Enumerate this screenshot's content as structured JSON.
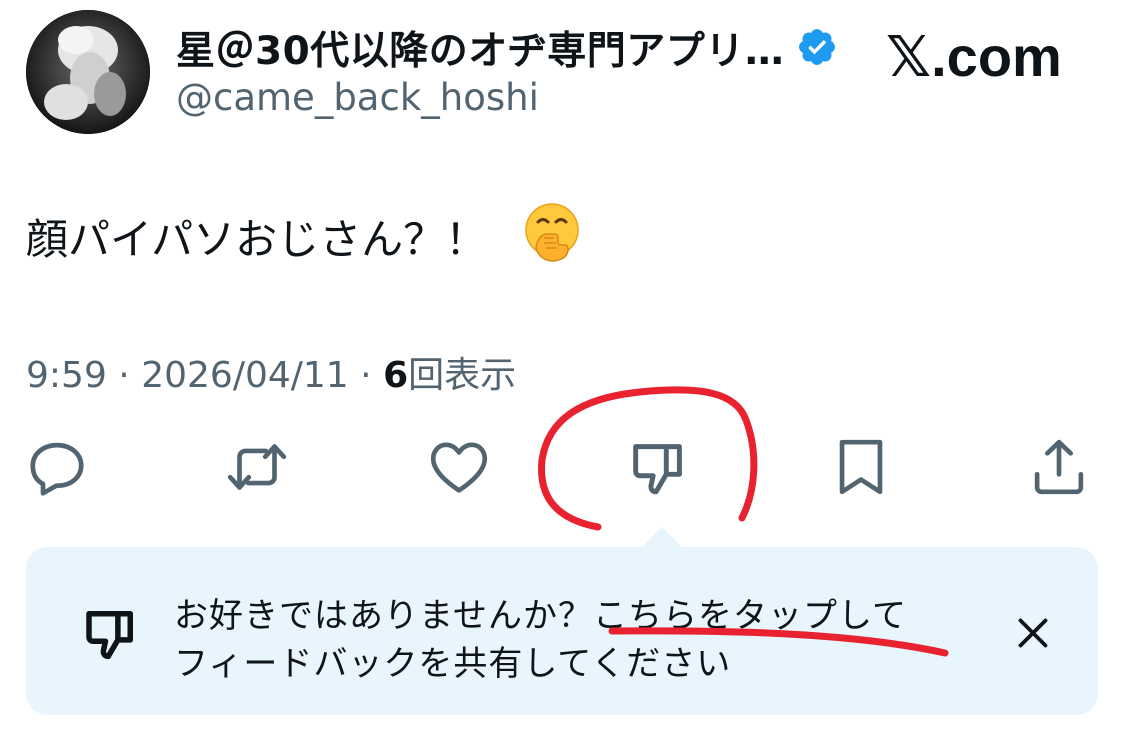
{
  "header": {
    "display_name": "星＠30代以降のオヂ専門アプリ…",
    "handle": "@came_back_hoshi",
    "site_label": "𝕏.com",
    "verified_icon": "verified-badge-icon",
    "verified_color": "#1d9bf0"
  },
  "tweet": {
    "text": "顔パイパソおじさん？！",
    "emoji_icon": "face-with-hand-over-mouth-icon"
  },
  "meta": {
    "time": "9:59",
    "separator": "·",
    "date": "2026/04/11",
    "views_count": "6",
    "views_label": "回表示"
  },
  "actions": [
    {
      "name": "reply",
      "icon": "reply-icon"
    },
    {
      "name": "repost",
      "icon": "repost-icon"
    },
    {
      "name": "like",
      "icon": "heart-icon"
    },
    {
      "name": "dislike",
      "icon": "thumbs-down-icon"
    },
    {
      "name": "bookmark",
      "icon": "bookmark-icon"
    },
    {
      "name": "share",
      "icon": "share-icon"
    }
  ],
  "tooltip": {
    "line1": "お好きではありませんか？こちらをタップして",
    "line2": "フィードバックを共有してください",
    "icon": "thumbs-down-icon",
    "close_icon": "close-icon",
    "background": "#e8f5fd"
  },
  "colors": {
    "text": "#0f1419",
    "muted": "#536471",
    "annotation": "#e8222e"
  }
}
